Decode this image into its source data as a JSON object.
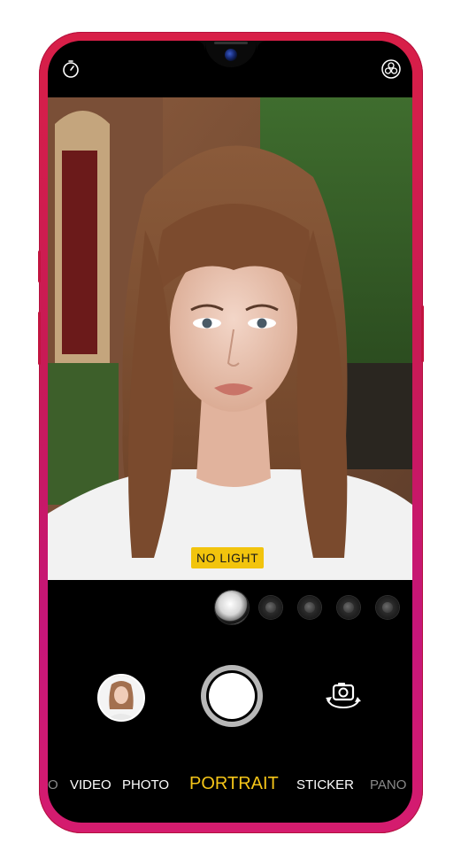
{
  "badge": {
    "light_mode": "NO  LIGHT"
  },
  "modes": {
    "items": [
      "O",
      "VIDEO",
      "PHOTO",
      "PORTRAIT",
      "STICKER",
      "PANO"
    ],
    "active": "PORTRAIT"
  },
  "icons": {
    "timer": "timer-icon",
    "filters": "filters-icon",
    "switch_camera": "switch-camera-icon",
    "gallery": "gallery-thumbnail"
  },
  "effects": {
    "count": 5,
    "selected_index": 0
  },
  "colors": {
    "accent": "#f5c518",
    "badge_bg": "#f2c40d",
    "phone_body": "#d81f48"
  }
}
